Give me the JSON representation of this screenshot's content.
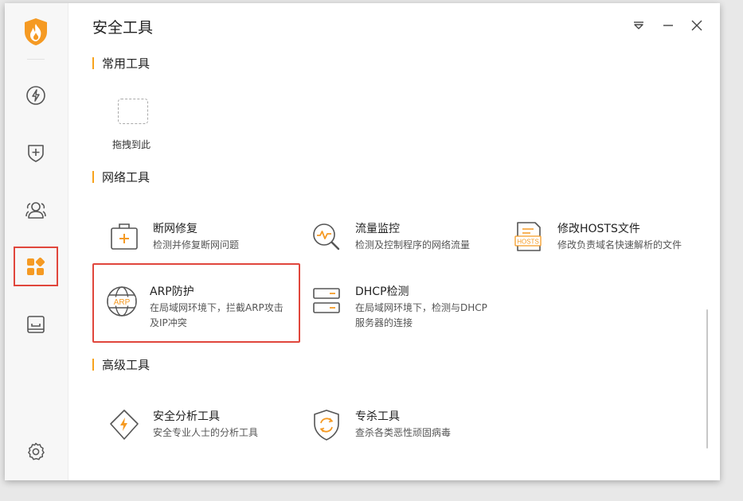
{
  "app": {
    "title": "安全工具"
  },
  "sidebar": {
    "items": [
      {
        "icon": "lightning-icon"
      },
      {
        "icon": "shield-plus-icon"
      },
      {
        "icon": "users-icon"
      },
      {
        "icon": "apps-icon",
        "active": true
      },
      {
        "icon": "inbox-icon"
      }
    ],
    "settings_icon": "gear-icon"
  },
  "window_controls": {
    "menu_icon": "menu-triangle-icon",
    "minimize_icon": "minimize-icon",
    "close_icon": "close-icon"
  },
  "sections": {
    "common": {
      "title": "常用工具",
      "drop_label": "拖拽到此"
    },
    "network": {
      "title": "网络工具",
      "tools": [
        {
          "name": "断网修复",
          "desc": "检测并修复断网问题",
          "icon": "first-aid-kit-icon"
        },
        {
          "name": "流量监控",
          "desc": "检测及控制程序的网络流量",
          "icon": "magnifier-pulse-icon"
        },
        {
          "name": "修改HOSTS文件",
          "desc": "修改负责域名快速解析的文件",
          "icon": "hosts-file-icon",
          "icon_text": "HOSTS"
        },
        {
          "name": "ARP防护",
          "desc": "在局域网环境下，拦截ARP攻击及IP冲突",
          "icon": "arp-globe-icon",
          "icon_text": "ARP"
        },
        {
          "name": "DHCP检测",
          "desc": "在局域网环境下，检测与DHCP服务器的连接",
          "icon": "server-icon"
        }
      ]
    },
    "advanced": {
      "title": "高级工具",
      "tools": [
        {
          "name": "安全分析工具",
          "desc": "安全专业人士的分析工具",
          "icon": "diamond-bolt-icon"
        },
        {
          "name": "专杀工具",
          "desc": "查杀各类恶性顽固病毒",
          "icon": "shield-refresh-icon"
        }
      ]
    }
  },
  "colors": {
    "accent": "#f7a31c",
    "highlight_border": "#e0463c",
    "icon_orange": "#f59a23",
    "icon_gray": "#555555"
  }
}
